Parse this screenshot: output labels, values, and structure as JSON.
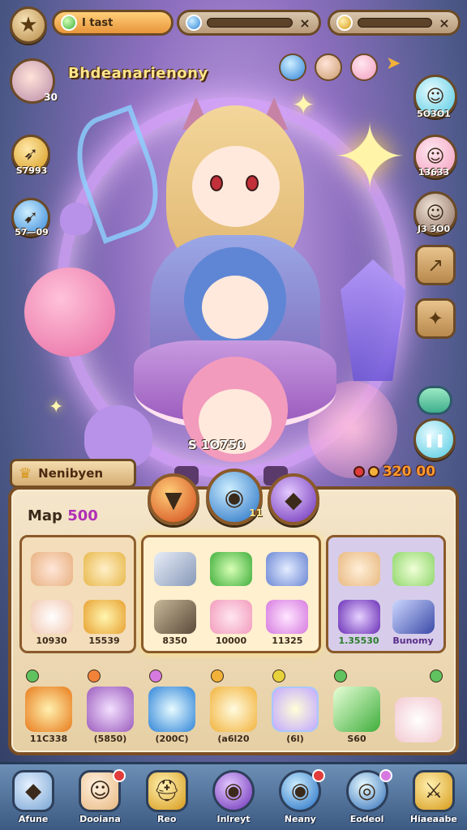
{
  "topbar": {
    "pill1_text": "I tast",
    "pill2_close": "×",
    "pill3_close": "×",
    "star_icon": "★"
  },
  "player": {
    "name": "Bhdeanarienony",
    "level_badge": "30"
  },
  "left_side": [
    {
      "value": "S7993"
    },
    {
      "value": "57—09"
    }
  ],
  "right_side": [
    {
      "value": "5O3O1"
    },
    {
      "value": "13633"
    },
    {
      "value": "J3 3O0"
    }
  ],
  "right_tiles": {
    "tile1_icon": "↗",
    "tile2_icon": "✦",
    "pause_icon": "❚❚"
  },
  "scene": {
    "center_value": "S 1O750",
    "score_value": "320 00"
  },
  "banner": {
    "label": "Nenibyen"
  },
  "panel": {
    "map_prefix": "Map ",
    "map_number": "500",
    "tab_mid_badge": "11",
    "group1": [
      {
        "value": ""
      },
      {
        "value": ""
      },
      {
        "value": "10930"
      },
      {
        "value": "15539"
      }
    ],
    "group2": [
      {
        "value": ""
      },
      {
        "value": ""
      },
      {
        "value": ""
      },
      {
        "value": "8350"
      },
      {
        "value": "10000"
      },
      {
        "value": "11325"
      }
    ],
    "group3": [
      {
        "value": ""
      },
      {
        "value": ""
      },
      {
        "value": "1.35530"
      },
      {
        "value": "Bunomy"
      }
    ],
    "bottom_row": [
      {
        "value": "11C338"
      },
      {
        "value": "(5850)"
      },
      {
        "value": "(200C)"
      },
      {
        "value": "(a6l20"
      },
      {
        "value": "(6l)"
      },
      {
        "value": "S60"
      },
      {
        "value": ""
      }
    ]
  },
  "nav": [
    {
      "label": "Afune"
    },
    {
      "label": "Dooiana"
    },
    {
      "label": "Reo"
    },
    {
      "label": "Inlreyt"
    },
    {
      "label": "Neany"
    },
    {
      "label": "Eodeol"
    },
    {
      "label": "Hiaeaabe"
    }
  ]
}
